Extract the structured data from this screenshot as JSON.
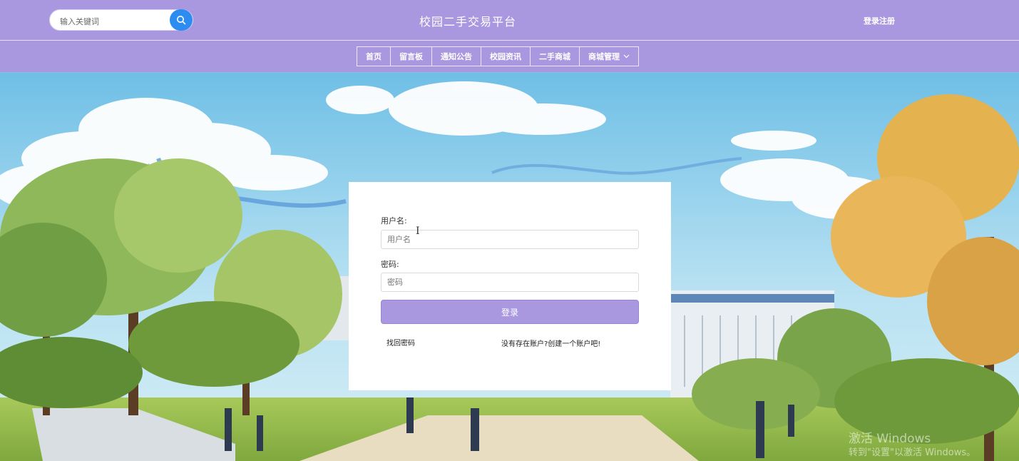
{
  "header": {
    "search": {
      "placeholder": "输入关键词",
      "icon": "search-icon"
    },
    "title": "校园二手交易平台",
    "login_register": "登录注册"
  },
  "nav": {
    "items": [
      {
        "label": "首页"
      },
      {
        "label": "留言板"
      },
      {
        "label": "通知公告"
      },
      {
        "label": "校园资讯"
      },
      {
        "label": "二手商城"
      },
      {
        "label": "商城管理",
        "icon": "chevron-down-icon"
      }
    ]
  },
  "login_form": {
    "username_label": "用户名:",
    "username_placeholder": "用户名",
    "password_label": "密码:",
    "password_placeholder": "密码",
    "login_button": "登录",
    "forgot_password": "找回密码",
    "register_prompt": "没有存在账户?创建一个账户吧!"
  },
  "watermark": {
    "line1": "激活 Windows",
    "line2": "转到\"设置\"以激活 Windows。"
  },
  "colors": {
    "header_bg": "#a998e0",
    "search_button": "#2d8cf0",
    "login_button": "#a998e0"
  }
}
